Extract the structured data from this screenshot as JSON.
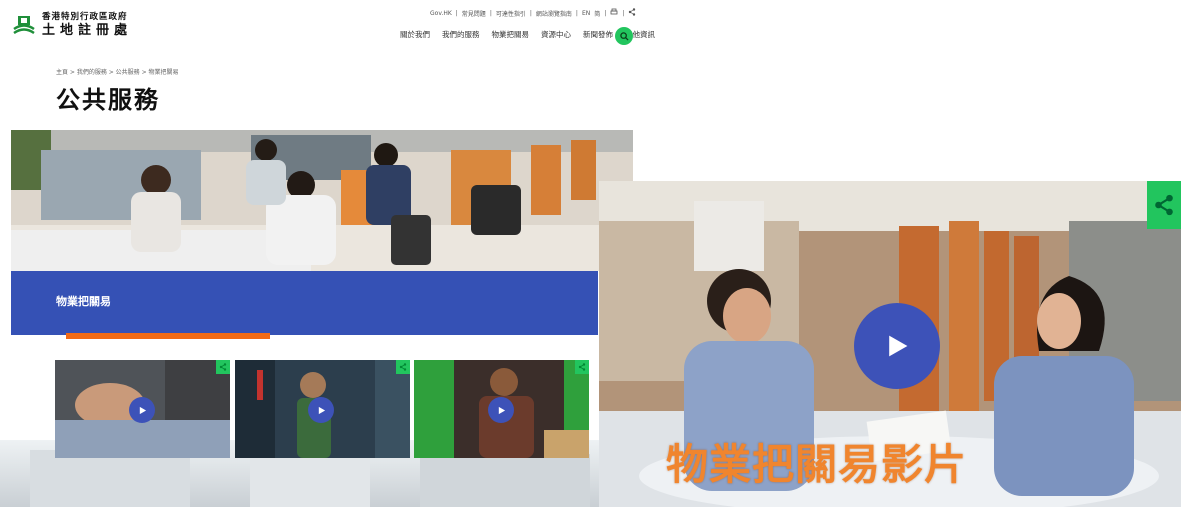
{
  "header": {
    "logo_line1": "香港特別行政區政府",
    "logo_line2": "土地註冊處",
    "util_links": [
      "Gov.HK",
      "常見問題",
      "可達性指引",
      "網站瀏覽指南",
      "EN",
      "简"
    ],
    "nav_items": [
      "關於我們",
      "我們的服務",
      "物業把關易",
      "資源中心",
      "新聞發佈",
      "其他資訊"
    ]
  },
  "breadcrumb": "主頁 > 我們的服務 > 公共服務 > 物業把關易",
  "page_title": "公共服務",
  "banner_label": "物業把關易",
  "video_caption": "物業把關易影片",
  "colors": {
    "brand_blue": "#3551b5",
    "accent_orange": "#f16a15",
    "share_green": "#22c55e"
  },
  "icons": {
    "search": "search-icon",
    "share": "share-icon",
    "play": "play-icon",
    "print": "print-icon"
  }
}
